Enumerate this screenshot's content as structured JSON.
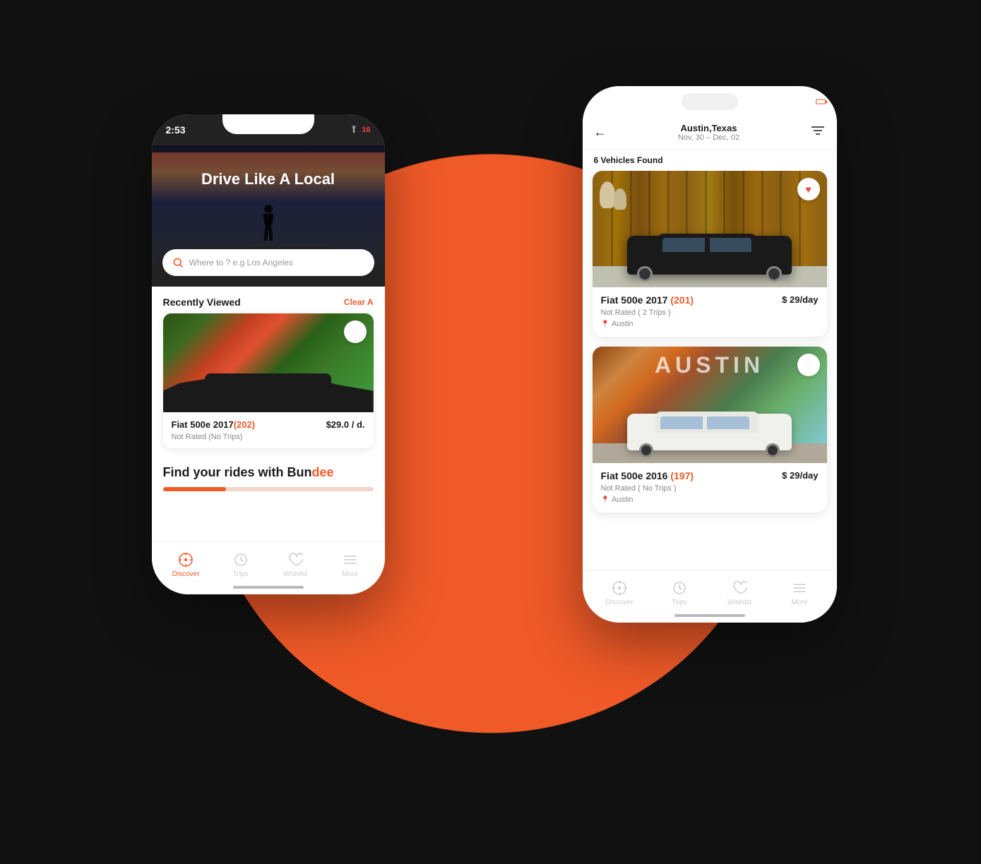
{
  "background": {
    "color": "#111111",
    "circle_color": "#F05A28"
  },
  "phone_left": {
    "status_bar": {
      "time": "2:53",
      "wifi": "wifi",
      "signal": "16"
    },
    "hero": {
      "title": "Drive Like A Local"
    },
    "search": {
      "placeholder": "Where to ? e.g Los Angeles"
    },
    "recently_viewed": {
      "title": "Recently Viewed",
      "action": "Clear A"
    },
    "car": {
      "name": "Fiat 500e 2017",
      "id": "(202)",
      "price": "$29.0 / d.",
      "rating": "Not Rated",
      "trips": "(No Trips)"
    },
    "find_rides": {
      "text_prefix": "Find your rides with Bun",
      "text_highlight": "dee"
    },
    "bottom_nav": {
      "items": [
        {
          "label": "Discover",
          "active": true
        },
        {
          "label": "Trips",
          "active": false
        },
        {
          "label": "Wishlist",
          "active": false
        },
        {
          "label": "More",
          "active": false
        }
      ]
    }
  },
  "phone_right": {
    "status_bar": {
      "battery_color": "#F05A28"
    },
    "header": {
      "back": "←",
      "location": "Austin,Texas",
      "dates": "Nov, 30 – Dec, 02",
      "filter": "filter"
    },
    "vehicles_count": "6 Vehicles Found",
    "cars": [
      {
        "name": "Fiat 500e 2017",
        "id": "(201)",
        "price": "$ 29/day",
        "rating": "Not Rated",
        "trips": "( 2 Trips )",
        "location": "Austin",
        "color": "black"
      },
      {
        "name": "Fiat 500e 2016",
        "id": "(197)",
        "price": "$ 29/day",
        "rating": "Not Rated",
        "trips": "( No Trips )",
        "location": "Austin",
        "color": "white"
      }
    ],
    "bottom_nav": {
      "items": [
        {
          "label": "Discover",
          "active": false
        },
        {
          "label": "Trips",
          "active": false
        },
        {
          "label": "Wishlist",
          "active": false
        },
        {
          "label": "More",
          "active": false
        }
      ]
    }
  }
}
